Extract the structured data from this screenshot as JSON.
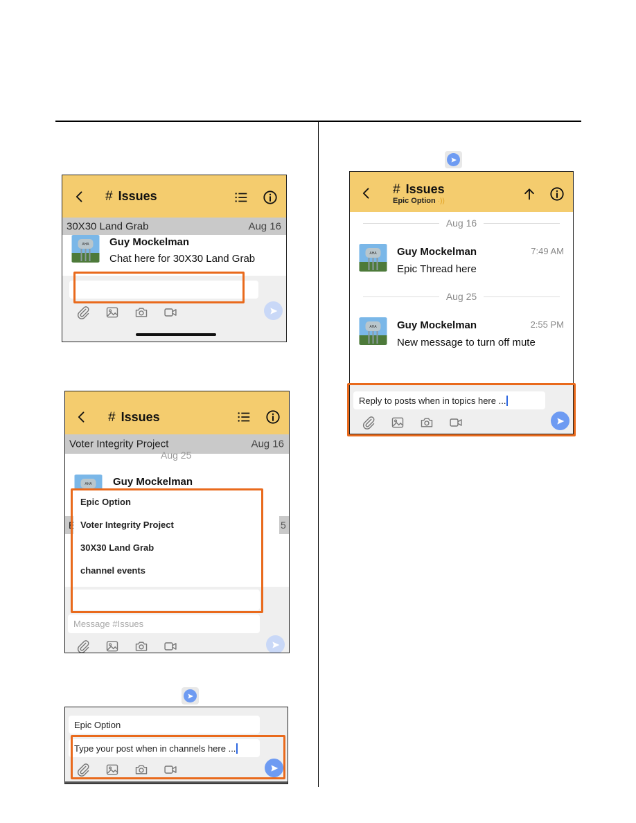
{
  "shot1": {
    "title": "Issues",
    "topic": "30X30 Land Grab",
    "topic_date": "Aug 16",
    "author": "Guy Mockelman",
    "message": "Chat here for 30X30 Land Grab"
  },
  "shot2": {
    "title": "Issues",
    "topic": "Voter Integrity Project",
    "topic_date": "Aug 16",
    "partial_divider": "Aug 25",
    "author": "Guy Mockelman",
    "hidden_left": "E",
    "hidden_right": "5",
    "menu": [
      "Epic Option",
      "Voter Integrity Project",
      "30X30 Land Grab",
      "channel events"
    ],
    "placeholder": "Message #Issues"
  },
  "shot3": {
    "selected_topic": "Epic Option",
    "input_text": "Type your post when in channels here ..."
  },
  "shot4": {
    "title": "Issues",
    "subtitle": "Epic Option",
    "messages": [
      {
        "divider": "Aug 16",
        "author": "Guy Mockelman",
        "time": "7:49 AM",
        "text": "Epic Thread here"
      },
      {
        "divider": "Aug 25",
        "author": "Guy Mockelman",
        "time": "2:55 PM",
        "text": "New message to turn off mute"
      }
    ],
    "input_text": "Reply to posts when in topics here ..."
  },
  "colors": {
    "header": "#f4cc6e",
    "highlight": "#e96a1c",
    "send": "#6e9bf2"
  },
  "icons": [
    "back-arrow-icon",
    "hash-icon",
    "topics-list-icon",
    "info-icon",
    "up-arrow-icon",
    "paperclip-icon",
    "image-icon",
    "camera-icon",
    "video-icon",
    "send-icon",
    "mute-icon"
  ]
}
